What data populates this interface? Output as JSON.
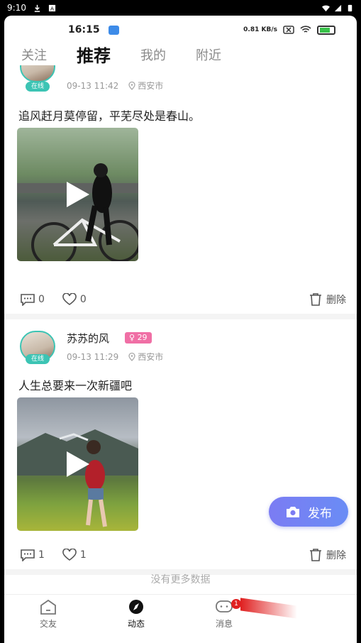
{
  "system_bar": {
    "time": "9:10"
  },
  "inner_status": {
    "time": "16:15",
    "net_speed": "0.81 KB/s"
  },
  "tabs": [
    {
      "label": "关注"
    },
    {
      "label": "推荐"
    },
    {
      "label": "我的"
    },
    {
      "label": "附近"
    }
  ],
  "posts": [
    {
      "online": "在线",
      "datetime": "09-13 11:42",
      "location": "西安市",
      "content": "追风赶月莫停留，平芜尽处是春山。",
      "comments": "0",
      "likes": "0",
      "delete_label": "删除"
    },
    {
      "username": "苏苏的风",
      "age": "29",
      "online": "在线",
      "datetime": "09-13 11:29",
      "location": "西安市",
      "content": "人生总要来一次新疆吧",
      "comments": "1",
      "likes": "1",
      "delete_label": "删除"
    }
  ],
  "no_more": "没有更多数据",
  "fab_label": "发布",
  "bottom_nav": [
    {
      "label": "交友"
    },
    {
      "label": "动态"
    },
    {
      "label": "消息",
      "badge": "1"
    },
    {
      "label": ""
    }
  ],
  "colors": {
    "accent": "#3cc4b4",
    "fab": "#7b7cf3",
    "badge": "#e02020",
    "age_badge": "#f06fa5"
  }
}
